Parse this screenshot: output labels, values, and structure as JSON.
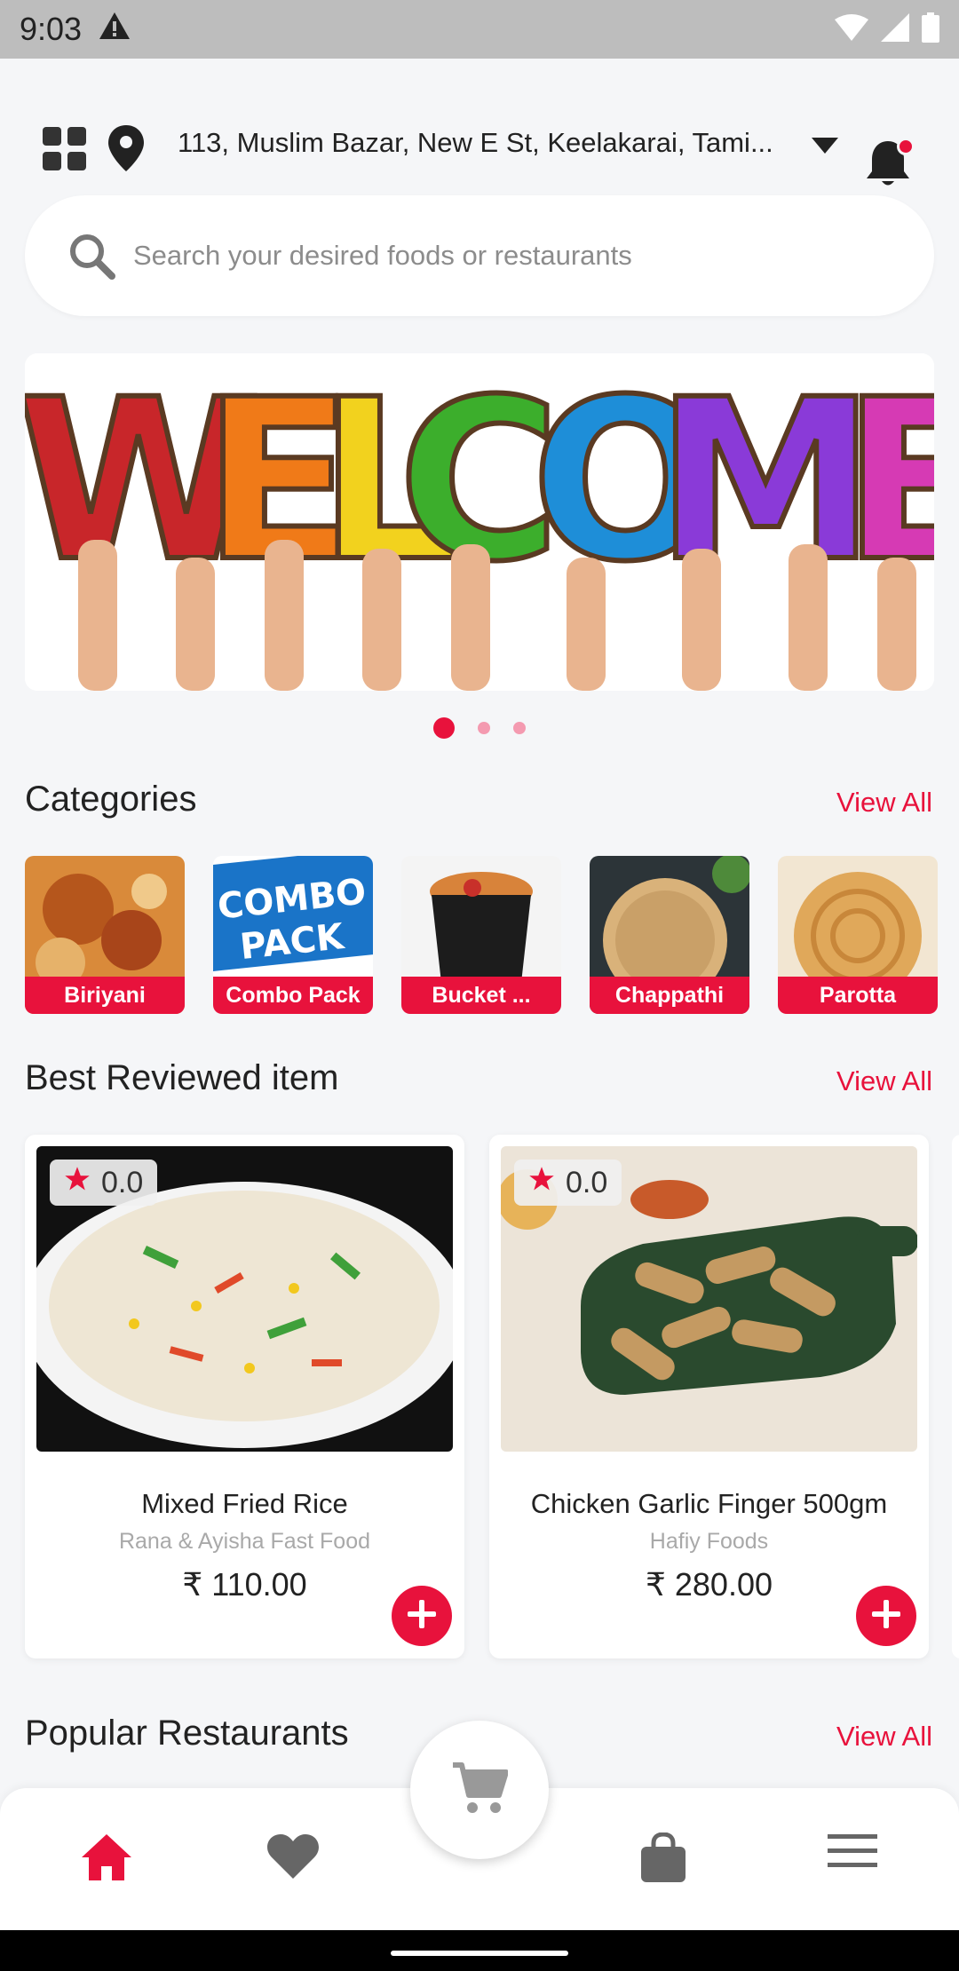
{
  "status_bar": {
    "time": "9:03"
  },
  "header": {
    "address": "113, Muslim Bazar, New E St, Keelakarai, Tami...",
    "icons": [
      "grid-icon",
      "location-pin-icon",
      "chevron-down-icon",
      "bell-icon"
    ]
  },
  "search": {
    "placeholder": "Search your desired foods or restaurants"
  },
  "banner": {
    "text": "WELCOME",
    "active_slide": 1,
    "slide_count": 3
  },
  "categories": {
    "title": "Categories",
    "view_all": "View All",
    "items": [
      {
        "label": "Biriyani"
      },
      {
        "label": "Combo Pack",
        "image_text": "COMBO PACK"
      },
      {
        "label": "Bucket ..."
      },
      {
        "label": "Chappathi"
      },
      {
        "label": "Parotta"
      }
    ]
  },
  "best_reviewed": {
    "title": "Best Reviewed item",
    "view_all": "View All",
    "items": [
      {
        "rating": "0.0",
        "name": "Mixed Fried Rice",
        "restaurant": "Rana & Ayisha Fast Food",
        "price": "₹ 110.00"
      },
      {
        "rating": "0.0",
        "name": "Chicken Garlic  Finger 500gm",
        "restaurant": "Hafiy Foods",
        "price": "₹ 280.00"
      }
    ]
  },
  "popular": {
    "title": "Popular Restaurants",
    "view_all": "View All"
  },
  "bottom_nav": {
    "items": [
      "home-icon",
      "heart-icon",
      "cart-icon",
      "shopping-bag-icon",
      "menu-icon"
    ],
    "active": "home"
  },
  "colors": {
    "accent": "#e8123c",
    "background": "#f5f6f8",
    "muted_text": "#8c8c8c"
  }
}
